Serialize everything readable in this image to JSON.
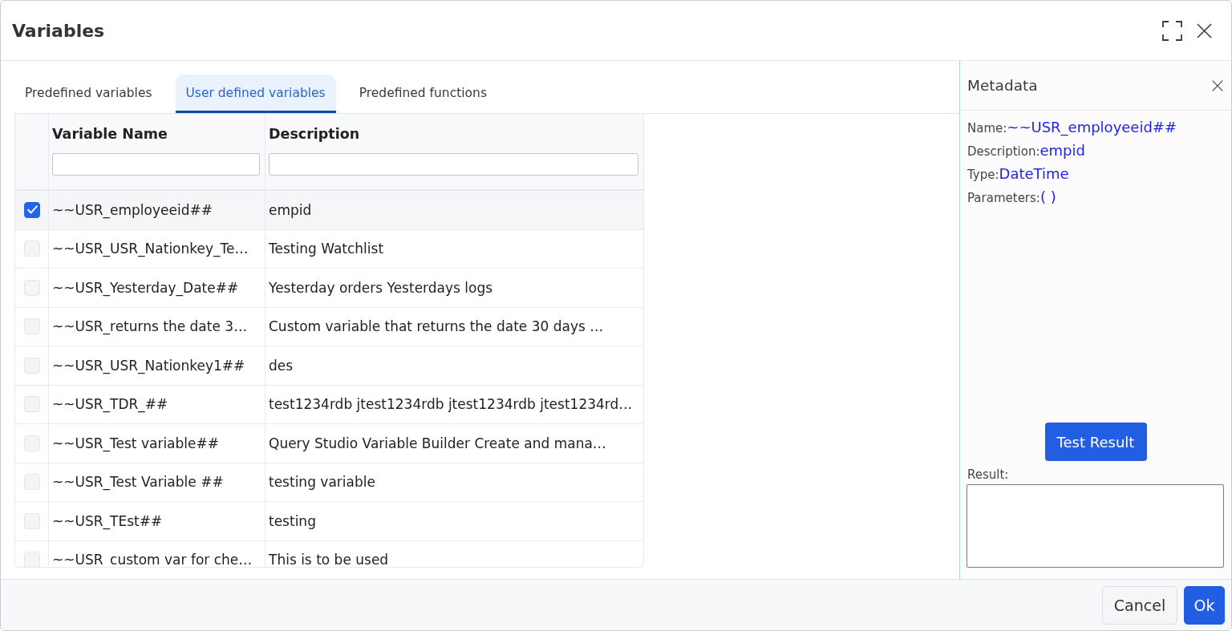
{
  "dialog": {
    "title": "Variables"
  },
  "tabs": [
    {
      "label": "Predefined variables",
      "selected": false
    },
    {
      "label": "User defined variables",
      "selected": true
    },
    {
      "label": "Predefined functions",
      "selected": false
    }
  ],
  "table": {
    "columns": [
      {
        "label": "Variable Name"
      },
      {
        "label": "Description"
      }
    ],
    "rows": [
      {
        "checked": true,
        "name": "~~USR_employeeid##",
        "description": "empid"
      },
      {
        "checked": false,
        "name": "~~USR_USR_Nationkey_Te…",
        "description": "Testing Watchlist"
      },
      {
        "checked": false,
        "name": "~~USR_Yesterday_Date##",
        "description": "Yesterday orders Yesterdays logs"
      },
      {
        "checked": false,
        "name": "~~USR_returns the date 3…",
        "description": "Custom variable that returns the date 30 days …"
      },
      {
        "checked": false,
        "name": "~~USR_USR_Nationkey1##",
        "description": "des"
      },
      {
        "checked": false,
        "name": "~~USR_TDR_##",
        "description": "test1234rdb jtest1234rdb jtest1234rdb jtest1234rd…"
      },
      {
        "checked": false,
        "name": "~~USR_Test variable##",
        "description": "Query Studio Variable Builder Create and mana…"
      },
      {
        "checked": false,
        "name": "~~USR_Test Variable ##",
        "description": "testing variable"
      },
      {
        "checked": false,
        "name": "~~USR_TEst##",
        "description": "testing"
      },
      {
        "checked": false,
        "name": "~~USR_custom var for che…",
        "description": "This is to be used"
      }
    ]
  },
  "metadata": {
    "title": "Metadata",
    "fields": [
      {
        "label": "Name:",
        "value": "~~USR_employeeid##"
      },
      {
        "label": "Description:",
        "value": "empid"
      },
      {
        "label": "Type:",
        "value": "DateTime"
      },
      {
        "label": "Parameters:",
        "value": "( )"
      }
    ],
    "test_button": "Test Result",
    "result_label": "Result:"
  },
  "footer": {
    "buttons": [
      {
        "label": "Cancel",
        "kind": "secondary"
      },
      {
        "label": "Ok",
        "kind": "primary"
      }
    ]
  }
}
